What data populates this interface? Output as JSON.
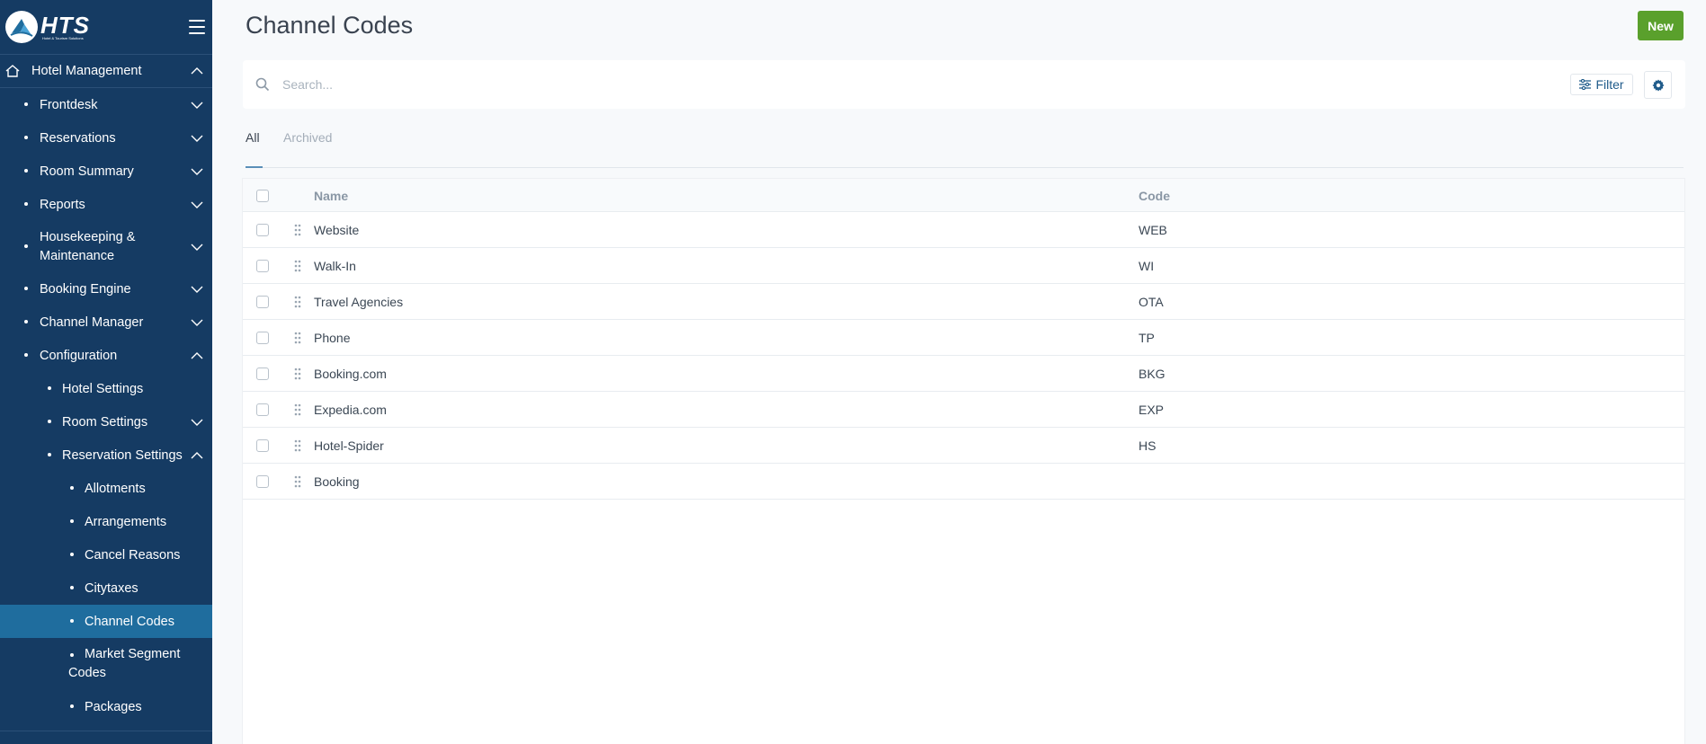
{
  "app": {
    "logo_text": "HTS",
    "logo_subtitle": "Hotel & Tourism Solutions"
  },
  "sidebar": {
    "home_label": "Hotel Management",
    "items": [
      {
        "label": "Frontdesk"
      },
      {
        "label": "Reservations"
      },
      {
        "label": "Room Summary"
      },
      {
        "label": "Reports"
      },
      {
        "label": "Housekeeping &",
        "label2": "Maintenance"
      },
      {
        "label": "Booking Engine"
      },
      {
        "label": "Channel Manager"
      },
      {
        "label": "Configuration"
      }
    ],
    "config_items": [
      {
        "label": "Hotel Settings"
      },
      {
        "label": "Room Settings"
      },
      {
        "label": "Reservation Settings"
      }
    ],
    "reservation_items": [
      {
        "label": "Allotments"
      },
      {
        "label": "Arrangements"
      },
      {
        "label": "Cancel Reasons"
      },
      {
        "label": "Citytaxes"
      },
      {
        "label": "Channel Codes"
      },
      {
        "label": "Market Segment",
        "label2": "Codes"
      },
      {
        "label": "Packages"
      }
    ]
  },
  "page": {
    "title": "Channel Codes",
    "new_button": "New"
  },
  "search": {
    "placeholder": "Search...",
    "filter_label": "Filter"
  },
  "tabs": [
    {
      "label": "All"
    },
    {
      "label": "Archived"
    }
  ],
  "table": {
    "columns": [
      "Name",
      "Code"
    ],
    "rows": [
      {
        "name": "Website",
        "code": "WEB"
      },
      {
        "name": "Walk-In",
        "code": "WI"
      },
      {
        "name": "Travel Agencies",
        "code": "OTA"
      },
      {
        "name": "Phone",
        "code": "TP"
      },
      {
        "name": "Booking.com",
        "code": "BKG"
      },
      {
        "name": "Expedia.com",
        "code": "EXP"
      },
      {
        "name": "Hotel-Spider",
        "code": "HS"
      },
      {
        "name": "Booking",
        "code": ""
      }
    ]
  },
  "colors": {
    "sidebar_bg": "#153b63",
    "sidebar_active": "#1f6d9e",
    "new_button": "#5aa02c"
  }
}
